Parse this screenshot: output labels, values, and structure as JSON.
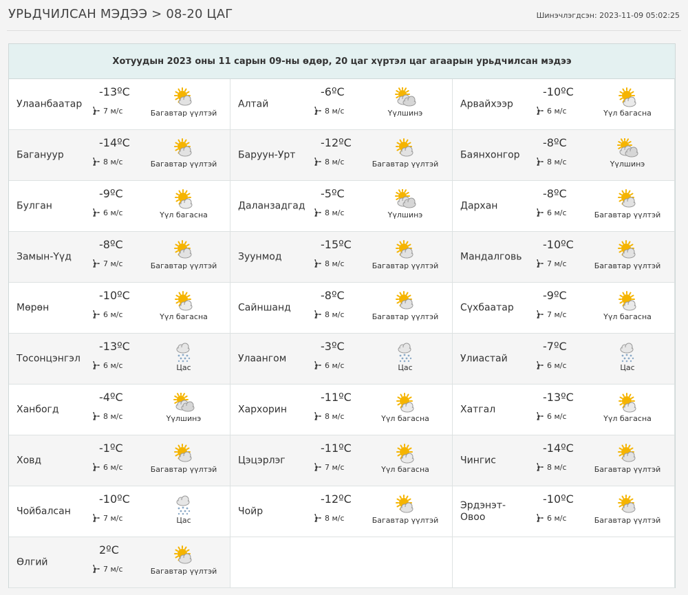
{
  "header": {
    "title": "УРЬДЧИЛСАН МЭДЭЭ > 08-20 ЦАГ",
    "updated": "Шинэчлэгдсэн: 2023-11-09 05:02:25"
  },
  "panel": {
    "heading": "Хотуудын 2023 оны 11 сарын 09-ны өдөр, 20 цаг хүртэл цаг агаарын урьдчилсан мэдээ"
  },
  "cities": [
    {
      "name": "Улаанбаатар",
      "temp": "-13ºC",
      "wind": "7 м/с",
      "condition": "Багавтар үүлтэй",
      "icon": "sun-cloud-icon"
    },
    {
      "name": "Алтай",
      "temp": "-6ºC",
      "wind": "8 м/с",
      "condition": "Үүлшинэ",
      "icon": "cloudy-sun-icon"
    },
    {
      "name": "Арвайхээр",
      "temp": "-10ºC",
      "wind": "6 м/с",
      "condition": "Үүл багасна",
      "icon": "sun-small-cloud-icon"
    },
    {
      "name": "Багануур",
      "temp": "-14ºC",
      "wind": "8 м/с",
      "condition": "Багавтар үүлтэй",
      "icon": "sun-cloud-icon"
    },
    {
      "name": "Баруун-Урт",
      "temp": "-12ºC",
      "wind": "8 м/с",
      "condition": "Багавтар үүлтэй",
      "icon": "sun-cloud-icon"
    },
    {
      "name": "Баянхонгор",
      "temp": "-8ºC",
      "wind": "8 м/с",
      "condition": "Үүлшинэ",
      "icon": "cloudy-sun-icon"
    },
    {
      "name": "Булган",
      "temp": "-9ºC",
      "wind": "6 м/с",
      "condition": "Үүл багасна",
      "icon": "sun-small-cloud-icon"
    },
    {
      "name": "Даланзадгад",
      "temp": "-5ºC",
      "wind": "8 м/с",
      "condition": "Үүлшинэ",
      "icon": "cloudy-sun-icon"
    },
    {
      "name": "Дархан",
      "temp": "-8ºC",
      "wind": "6 м/с",
      "condition": "Багавтар үүлтэй",
      "icon": "sun-cloud-icon"
    },
    {
      "name": "Замын-Үүд",
      "temp": "-8ºC",
      "wind": "7 м/с",
      "condition": "Багавтар үүлтэй",
      "icon": "sun-cloud-icon"
    },
    {
      "name": "Зуунмод",
      "temp": "-15ºC",
      "wind": "8 м/с",
      "condition": "Багавтар үүлтэй",
      "icon": "sun-cloud-icon"
    },
    {
      "name": "Мандалговь",
      "temp": "-10ºC",
      "wind": "7 м/с",
      "condition": "Багавтар үүлтэй",
      "icon": "sun-cloud-icon"
    },
    {
      "name": "Мөрөн",
      "temp": "-10ºC",
      "wind": "6 м/с",
      "condition": "Үүл багасна",
      "icon": "sun-small-cloud-icon"
    },
    {
      "name": "Сайншанд",
      "temp": "-8ºC",
      "wind": "8 м/с",
      "condition": "Багавтар үүлтэй",
      "icon": "sun-cloud-icon"
    },
    {
      "name": "Сүхбаатар",
      "temp": "-9ºC",
      "wind": "7 м/с",
      "condition": "Үүл багасна",
      "icon": "sun-small-cloud-icon"
    },
    {
      "name": "Тосонцэнгэл",
      "temp": "-13ºC",
      "wind": "6 м/с",
      "condition": "Цас",
      "icon": "snow-icon"
    },
    {
      "name": "Улаангом",
      "temp": "-3ºC",
      "wind": "6 м/с",
      "condition": "Цас",
      "icon": "snow-icon"
    },
    {
      "name": "Улиастай",
      "temp": "-7ºC",
      "wind": "6 м/с",
      "condition": "Цас",
      "icon": "snow-icon"
    },
    {
      "name": "Ханбогд",
      "temp": "-4ºC",
      "wind": "8 м/с",
      "condition": "Үүлшинэ",
      "icon": "cloudy-sun-icon"
    },
    {
      "name": "Хархорин",
      "temp": "-11ºC",
      "wind": "8 м/с",
      "condition": "Үүл багасна",
      "icon": "sun-small-cloud-icon"
    },
    {
      "name": "Хатгал",
      "temp": "-13ºC",
      "wind": "6 м/с",
      "condition": "Үүл багасна",
      "icon": "sun-small-cloud-icon"
    },
    {
      "name": "Ховд",
      "temp": "-1ºC",
      "wind": "6 м/с",
      "condition": "Багавтар үүлтэй",
      "icon": "sun-cloud-icon"
    },
    {
      "name": "Цэцэрлэг",
      "temp": "-11ºC",
      "wind": "7 м/с",
      "condition": "Үүл багасна",
      "icon": "sun-small-cloud-icon"
    },
    {
      "name": "Чингис",
      "temp": "-14ºC",
      "wind": "8 м/с",
      "condition": "Багавтар үүлтэй",
      "icon": "sun-cloud-icon"
    },
    {
      "name": "Чойбалсан",
      "temp": "-10ºC",
      "wind": "7 м/с",
      "condition": "Цас",
      "icon": "snow-icon"
    },
    {
      "name": "Чойр",
      "temp": "-12ºC",
      "wind": "8 м/с",
      "condition": "Багавтар үүлтэй",
      "icon": "sun-cloud-icon"
    },
    {
      "name": "Эрдэнэт-Овоо",
      "temp": "-10ºC",
      "wind": "6 м/с",
      "condition": "Багавтар үүлтэй",
      "icon": "sun-cloud-icon"
    },
    {
      "name": "Өлгий",
      "temp": "2ºC",
      "wind": "7 м/с",
      "condition": "Багавтар үүлтэй",
      "icon": "sun-cloud-icon"
    }
  ],
  "colors": {
    "panel_header_bg": "#e4f1f1",
    "sun": "#f5b400",
    "cloud": "#dcdcdc"
  }
}
